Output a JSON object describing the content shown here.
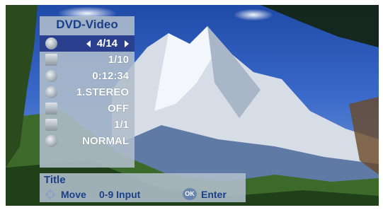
{
  "menu": {
    "title": "DVD-Video",
    "rows": [
      {
        "icon": "title-icon",
        "value": "4/14",
        "selected": true
      },
      {
        "icon": "chapter-icon",
        "value": "1/10"
      },
      {
        "icon": "time-icon",
        "value": "0:12:34"
      },
      {
        "icon": "audio-icon",
        "value": "1.STEREO"
      },
      {
        "icon": "subtitle-icon",
        "value": "OFF"
      },
      {
        "icon": "angle-icon",
        "value": "1/1"
      },
      {
        "icon": "sound-icon",
        "value": "NORMAL"
      }
    ]
  },
  "help": {
    "title": "Title",
    "move": "Move",
    "input": "0-9 Input",
    "ok": "OK",
    "enter": "Enter"
  },
  "colors": {
    "panel": "#b0becb",
    "selected_row": "#2a3f8e",
    "label_text": "#1b3f8a"
  }
}
